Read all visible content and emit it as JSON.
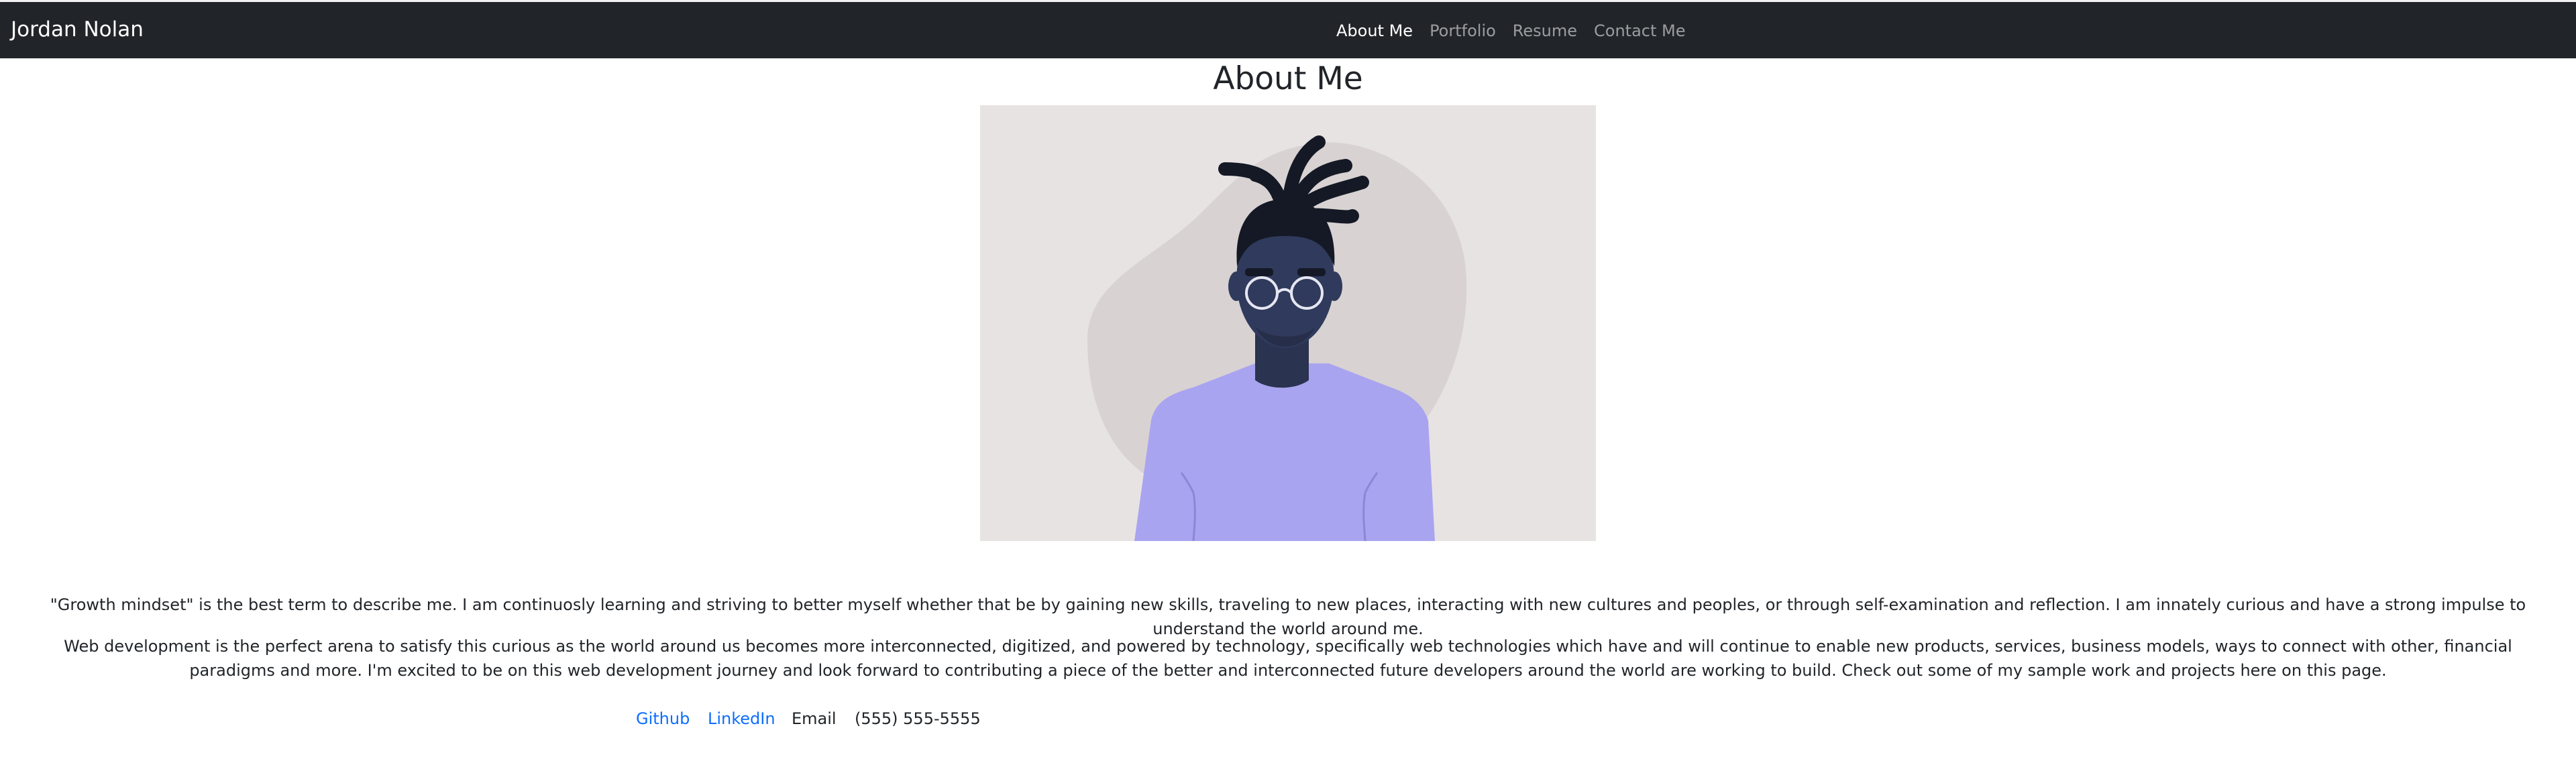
{
  "navbar": {
    "brand": "Jordan Nolan",
    "links": [
      {
        "label": "About Me",
        "active": true
      },
      {
        "label": "Portfolio",
        "active": false
      },
      {
        "label": "Resume",
        "active": false
      },
      {
        "label": "Contact Me",
        "active": false
      }
    ]
  },
  "main": {
    "title": "About Me",
    "bio": [
      "\"Growth mindset\" is the best term to describe me. I am continuosly learning and striving to better myself whether that be by gaining new skills, traveling to new places, interacting with new cultures and peoples, or through self-examination and reflection. I am innately curious and have a strong impulse to understand the world around me.",
      "Web development is the perfect arena to satisfy this curious as the world around us becomes more interconnected, digitized, and powered by technology, specifically web technologies which have and will continue to enable new products, services, business models, ways to connect with other, financial paradigms and more. I'm excited to be on this web development journey and look forward to contributing a piece of the better and interconnected future developers around the world are working to build. Check out some of my sample work and projects here on this page."
    ]
  },
  "contact": {
    "github": "Github",
    "linkedin": "LinkedIn",
    "email": "Email",
    "phone": "(555) 555-5555"
  },
  "colors": {
    "navbar_bg": "#212529",
    "link": "#0d6efd",
    "portrait_bg": "#e8e3e3",
    "shirt": "#a9a4f0",
    "skin": "#2f3a5c"
  }
}
